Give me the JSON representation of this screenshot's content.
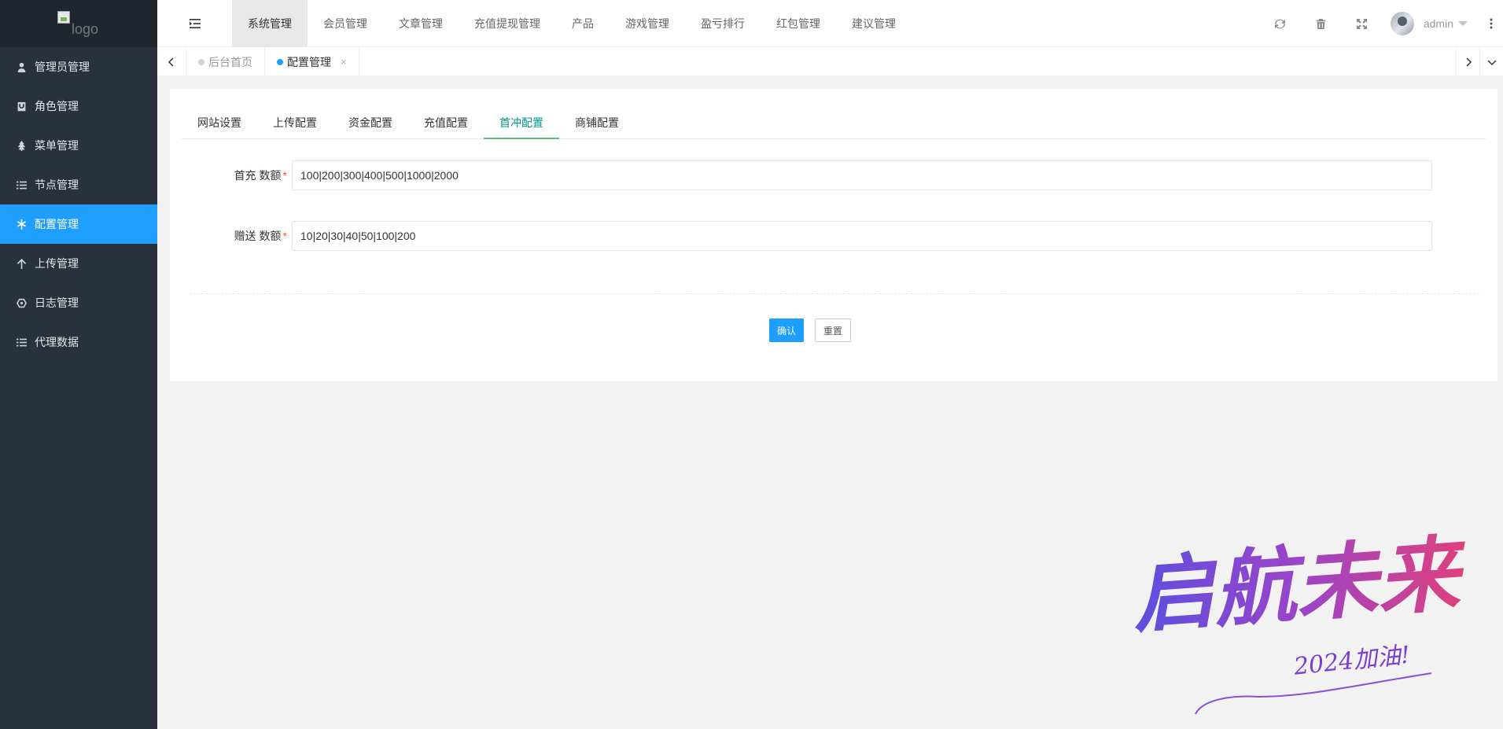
{
  "logo": {
    "alt_text": "logo"
  },
  "sidebar": {
    "items": [
      {
        "label": "管理员管理",
        "icon": "user-icon",
        "active": false
      },
      {
        "label": "角色管理",
        "icon": "role-icon",
        "active": false
      },
      {
        "label": "菜单管理",
        "icon": "tree-icon",
        "active": false
      },
      {
        "label": "节点管理",
        "icon": "list-icon",
        "active": false
      },
      {
        "label": "配置管理",
        "icon": "asterisk-icon",
        "active": true
      },
      {
        "label": "上传管理",
        "icon": "arrow-up-icon",
        "active": false
      },
      {
        "label": "日志管理",
        "icon": "hexagon-icon",
        "active": false
      },
      {
        "label": "代理数据",
        "icon": "list-icon",
        "active": false
      }
    ]
  },
  "header": {
    "nav": [
      {
        "label": "系统管理",
        "active": true
      },
      {
        "label": "会员管理"
      },
      {
        "label": "文章管理"
      },
      {
        "label": "充值提现管理"
      },
      {
        "label": "产品"
      },
      {
        "label": "游戏管理"
      },
      {
        "label": "盈亏排行"
      },
      {
        "label": "红包管理"
      },
      {
        "label": "建议管理"
      }
    ],
    "user_name": "admin"
  },
  "tabs": [
    {
      "label": "后台首页",
      "active": false
    },
    {
      "label": "配置管理",
      "active": true,
      "close": "×"
    }
  ],
  "form": {
    "tabs": [
      {
        "label": "网站设置"
      },
      {
        "label": "上传配置"
      },
      {
        "label": "资金配置"
      },
      {
        "label": "充值配置"
      },
      {
        "label": "首冲配置",
        "active": true
      },
      {
        "label": "商铺配置"
      }
    ],
    "fields": [
      {
        "label": "首充 数额",
        "required_mark": "*",
        "value": "100|200|300|400|500|1000|2000"
      },
      {
        "label": "赠送 数额",
        "required_mark": "*",
        "value": "10|20|30|40|50|100|200"
      }
    ],
    "submit_label": "确认",
    "reset_label": "重置"
  },
  "colors": {
    "sidebar_bg": "#28313c",
    "accent": "#1e9fff",
    "tab_active": "#009688"
  },
  "watermark": {
    "main_text": "启航未来",
    "sub_text": "2024加油!"
  }
}
